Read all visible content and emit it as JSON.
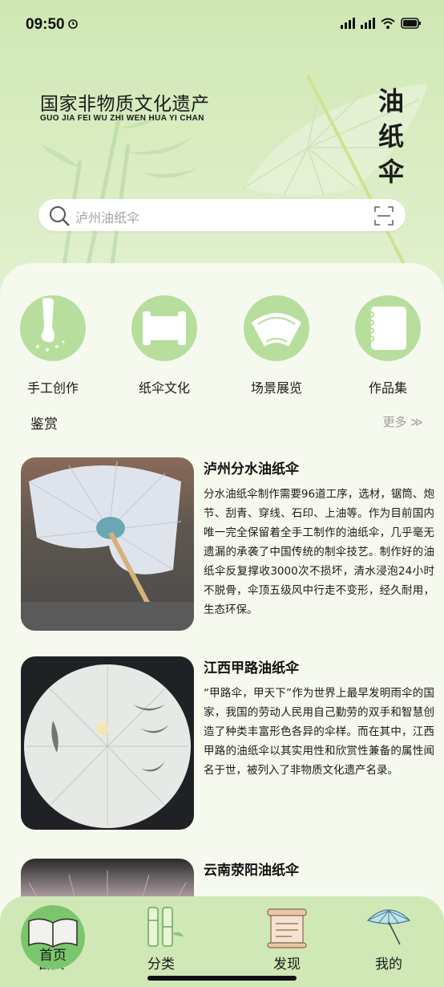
{
  "status": {
    "time": "09:50"
  },
  "header": {
    "title": "国家非物质文化遗产",
    "pinyin": "GUO JIA FEI WU ZHI WEN HUA YI CHAN",
    "vertical_title": [
      "油",
      "纸",
      "伞"
    ]
  },
  "search": {
    "placeholder": "泸州油纸伞"
  },
  "features": [
    {
      "label": "手工创作",
      "icon": "brush-hand-icon"
    },
    {
      "label": "纸伞文化",
      "icon": "scroll-icon"
    },
    {
      "label": "场景展览",
      "icon": "fan-icon"
    },
    {
      "label": "作品集",
      "icon": "notebook-icon"
    }
  ],
  "section": {
    "title": "鉴赏",
    "more": "更多 ≫"
  },
  "cards": [
    {
      "title": "泸州分水油纸伞",
      "text": "分水油纸伞制作需要96道工序，选材，锯筒、炮节、刮青、穿线、石印、上油等。作为目前国内唯一完全保留着全手工制作的油纸伞，几乎毫无遗漏的承袭了中国传统的制伞技艺。制作好的油纸伞反复撑收3000次不损坏，清水浸泡24小时不脱骨，伞顶五级风中行走不变形，经久耐用，生态环保。"
    },
    {
      "title": "江西甲路油纸伞",
      "text": "“甲路伞，甲天下”作为世界上最早发明雨伞的国家，我国的劳动人民用自己勤劳的双手和智慧创造了种类丰富形色各异的伞样。而在其中，江西甲路的油纸伞以其实用性和欣赏性兼备的属性闻名于世，被列入了非物质文化遗产名录。"
    },
    {
      "title": "云南荥阳油纸伞",
      "text": ""
    }
  ],
  "tabs": [
    {
      "label": "首页",
      "icon": "book-icon",
      "active": true
    },
    {
      "label": "分类",
      "icon": "bamboo-icon",
      "active": false
    },
    {
      "label": "发现",
      "icon": "scroll-icon",
      "active": false
    },
    {
      "label": "我的",
      "icon": "umbrella-icon",
      "active": false
    }
  ],
  "colors": {
    "accent": "#7bc66d",
    "feature_bg": "#b7de9d",
    "tab_bar": "#cfe8b6"
  }
}
